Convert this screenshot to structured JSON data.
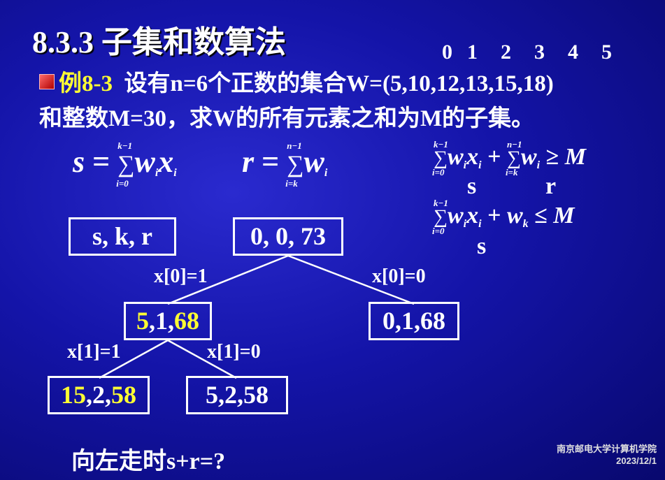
{
  "title": "8.3.3 子集和数算法",
  "indices": [
    "0",
    "1",
    "2",
    "3",
    "4",
    "5"
  ],
  "problem": {
    "label": "例8-3",
    "line1": "设有n=6个正数的集合W=(5,10,12,13,15,18)",
    "line2": "和整数M=30，求W的所有元素之和为M的子集。"
  },
  "formulas": {
    "s_lhs": "s",
    "r_lhs": "r",
    "eq": "=",
    "sum_k_minus_1": "k−1",
    "sum_n_minus_1": "n−1",
    "idx_i0": "i=0",
    "idx_ik": "i=k",
    "w": "w",
    "x": "x",
    "sub_i": "i",
    "sub_k": "k",
    "plus": "+",
    "ge": "≥",
    "le": "≤",
    "M": "M",
    "note_s": "s",
    "note_r": "r",
    "note_s2": "s"
  },
  "tree": {
    "legend": "s, k, r",
    "root": "0, 0, 73",
    "left_edge": "x[0]=1",
    "right_edge": "x[0]=0",
    "n1": {
      "a": "5",
      "b": ",1,",
      "c": "68"
    },
    "n2": "0,1,68",
    "ll_edge": "x[1]=1",
    "lr_edge": "x[1]=0",
    "n3": {
      "a": "15",
      "b": ",2,",
      "c": "58"
    },
    "n4": "5,2,58"
  },
  "question": "向左走时s+r=?",
  "footer": {
    "org": "南京邮电大学计算机学院",
    "date": "2023/12/1"
  },
  "colors": {
    "background": "#1414a8",
    "highlight": "#ffff33",
    "bullet": "#d40000"
  }
}
